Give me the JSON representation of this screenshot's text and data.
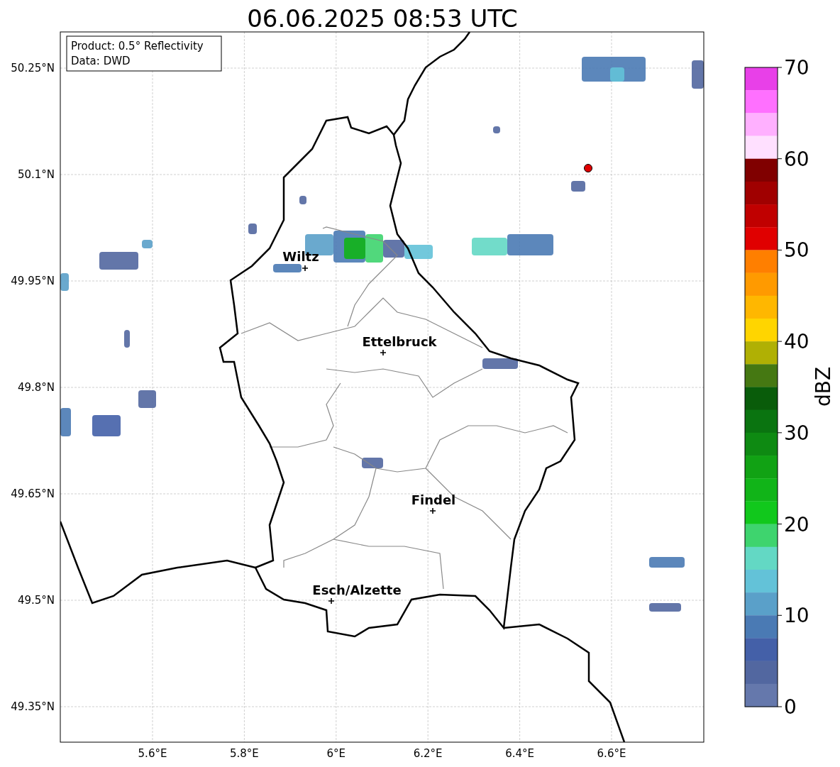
{
  "title": "06.06.2025 08:53 UTC",
  "info_box": [
    "Product: 0.5° Reflectivity",
    "Data: DWD"
  ],
  "map": {
    "y_ticks": [
      "50.25°N",
      "50.1°N",
      "49.95°N",
      "49.8°N",
      "49.65°N",
      "49.5°N",
      "49.35°N"
    ],
    "x_ticks": [
      "5.6°E",
      "5.8°E",
      "6°E",
      "6.2°E",
      "6.4°E",
      "6.6°E"
    ],
    "cities": [
      {
        "name": "Wiltz"
      },
      {
        "name": "Ettelbruck"
      },
      {
        "name": "Findel"
      },
      {
        "name": "Esch/Alzette"
      }
    ]
  },
  "colorbar": {
    "label": "dBZ",
    "ticks": [
      "70",
      "60",
      "50",
      "40",
      "30",
      "20",
      "10",
      "0"
    ],
    "segments": [
      {
        "color": "#e840e8"
      },
      {
        "color": "#ff70ff"
      },
      {
        "color": "#ffb0ff"
      },
      {
        "color": "#ffe0ff"
      },
      {
        "color": "#800000"
      },
      {
        "color": "#a00000"
      },
      {
        "color": "#c00000"
      },
      {
        "color": "#e00000"
      },
      {
        "color": "#ff7f00"
      },
      {
        "color": "#ff9a00"
      },
      {
        "color": "#ffb700"
      },
      {
        "color": "#ffd500"
      },
      {
        "color": "#b0b004"
      },
      {
        "color": "#457812"
      },
      {
        "color": "#095c0a"
      },
      {
        "color": "#0a7410"
      },
      {
        "color": "#0e8a12"
      },
      {
        "color": "#11a214"
      },
      {
        "color": "#11b418"
      },
      {
        "color": "#11c81c"
      },
      {
        "color": "#3ed46e"
      },
      {
        "color": "#63d8c4"
      },
      {
        "color": "#63c2d8"
      },
      {
        "color": "#5aa0c9"
      },
      {
        "color": "#4a7ab4"
      },
      {
        "color": "#4460a8"
      },
      {
        "color": "#5267a0"
      },
      {
        "color": "#6578ac"
      }
    ]
  }
}
